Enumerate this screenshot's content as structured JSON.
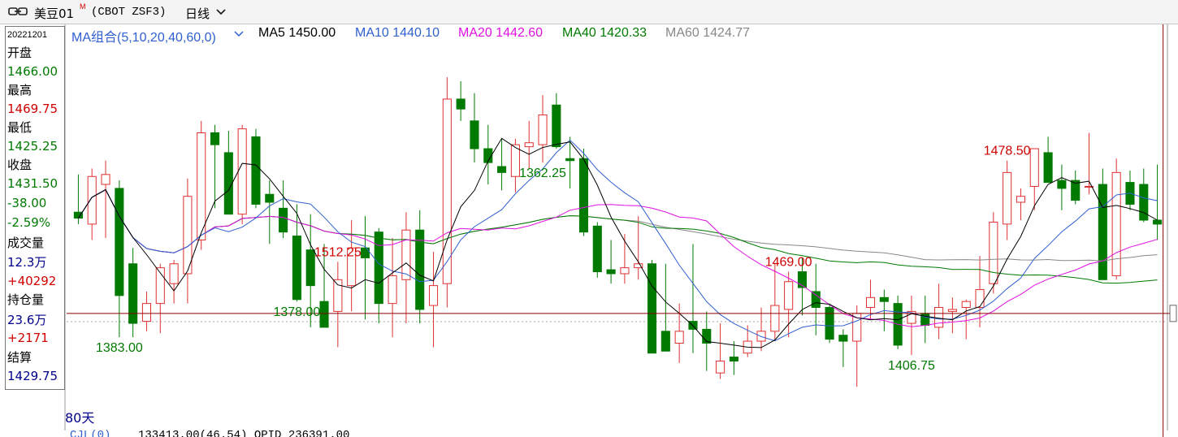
{
  "header": {
    "symbol": "美豆01",
    "symbol_sup": "M",
    "code": "(CBOT ZSF3)",
    "period": "日线",
    "icons": [
      "link-icon",
      "chevron-down-icon"
    ]
  },
  "side_panel": {
    "date": "20221201",
    "open_label": "开盘",
    "open": "1466.00",
    "high_label": "最高",
    "high": "1469.75",
    "low_label": "最低",
    "low": "1425.25",
    "close_label": "收盘",
    "close": "1431.50",
    "change": "-38.00",
    "change_pct": "-2.59%",
    "volume_label": "成交量",
    "volume": "12.3万",
    "volume_change": "+40292",
    "oi_label": "持仓量",
    "oi": "23.6万",
    "oi_change": "+2171",
    "settle_label": "结算",
    "settle": "1429.75"
  },
  "ma_legend": {
    "group": "MA组合(5,10,20,40,60,0)",
    "ma5": "MA5 1450.00",
    "ma10": "MA10 1440.10",
    "ma20": "MA20 1442.60",
    "ma40": "MA40 1420.33",
    "ma60": "MA60 1424.77"
  },
  "footer": {
    "days": "80天",
    "indicator": "CJL(0)",
    "values": "133413.00(46.54)   OPID 236391.00"
  },
  "colors": {
    "up": "#e03030",
    "down": "#007a00",
    "ma5": "#000000",
    "ma10": "#3060d0",
    "ma20": "#e010e0",
    "ma40": "#007a00",
    "ma60": "#888888",
    "crosshair": "#8b0000",
    "label_blue": "#00008b"
  },
  "chart_data": {
    "type": "candlestick",
    "ylim": [
      1345,
      1530
    ],
    "annotations": [
      {
        "label": "1512.25",
        "index": 19,
        "kind": "high"
      },
      {
        "label": "1383.00",
        "index": 3,
        "kind": "low"
      },
      {
        "label": "1378.00",
        "index": 16,
        "kind": "low"
      },
      {
        "label": "1362.25",
        "index": 34,
        "kind": "low"
      },
      {
        "label": "1469.00",
        "index": 52,
        "kind": "high"
      },
      {
        "label": "1406.75",
        "index": 61,
        "kind": "low"
      },
      {
        "label": "1478.50",
        "index": 68,
        "kind": "high"
      }
    ],
    "horizontal_reference": 1395,
    "candles": [
      {
        "o": 1446,
        "h": 1465,
        "l": 1440,
        "c": 1443
      },
      {
        "o": 1440,
        "h": 1468,
        "l": 1432,
        "c": 1464
      },
      {
        "o": 1460,
        "h": 1472,
        "l": 1433,
        "c": 1465
      },
      {
        "o": 1458,
        "h": 1462,
        "l": 1383,
        "c": 1404
      },
      {
        "o": 1420,
        "h": 1428,
        "l": 1383,
        "c": 1390
      },
      {
        "o": 1391,
        "h": 1406,
        "l": 1386,
        "c": 1400
      },
      {
        "o": 1400,
        "h": 1420,
        "l": 1385,
        "c": 1418
      },
      {
        "o": 1410,
        "h": 1422,
        "l": 1400,
        "c": 1420
      },
      {
        "o": 1415,
        "h": 1463,
        "l": 1400,
        "c": 1454
      },
      {
        "o": 1432,
        "h": 1492,
        "l": 1427,
        "c": 1486
      },
      {
        "o": 1486,
        "h": 1490,
        "l": 1448,
        "c": 1480
      },
      {
        "o": 1476,
        "h": 1487,
        "l": 1445,
        "c": 1445
      },
      {
        "o": 1445,
        "h": 1490,
        "l": 1440,
        "c": 1488
      },
      {
        "o": 1484,
        "h": 1488,
        "l": 1448,
        "c": 1450
      },
      {
        "o": 1455,
        "h": 1462,
        "l": 1430,
        "c": 1451
      },
      {
        "o": 1448,
        "h": 1462,
        "l": 1433,
        "c": 1436
      },
      {
        "o": 1434,
        "h": 1450,
        "l": 1401,
        "c": 1402
      },
      {
        "o": 1427,
        "h": 1445,
        "l": 1388,
        "c": 1409
      },
      {
        "o": 1401,
        "h": 1430,
        "l": 1388,
        "c": 1388
      },
      {
        "o": 1396,
        "h": 1421,
        "l": 1378,
        "c": 1412
      },
      {
        "o": 1409,
        "h": 1442,
        "l": 1396,
        "c": 1428
      },
      {
        "o": 1428,
        "h": 1444,
        "l": 1392,
        "c": 1423
      },
      {
        "o": 1436,
        "h": 1438,
        "l": 1390,
        "c": 1400
      },
      {
        "o": 1400,
        "h": 1433,
        "l": 1383,
        "c": 1414
      },
      {
        "o": 1412,
        "h": 1446,
        "l": 1390,
        "c": 1437
      },
      {
        "o": 1437,
        "h": 1447,
        "l": 1390,
        "c": 1397
      },
      {
        "o": 1399,
        "h": 1426,
        "l": 1378,
        "c": 1409
      },
      {
        "o": 1410,
        "h": 1514,
        "l": 1398,
        "c": 1503
      },
      {
        "o": 1503,
        "h": 1512,
        "l": 1492,
        "c": 1498
      },
      {
        "o": 1492,
        "h": 1506,
        "l": 1471,
        "c": 1478
      },
      {
        "o": 1478,
        "h": 1490,
        "l": 1460,
        "c": 1471
      },
      {
        "o": 1469,
        "h": 1483,
        "l": 1457,
        "c": 1466
      },
      {
        "o": 1464,
        "h": 1483,
        "l": 1456,
        "c": 1480
      },
      {
        "o": 1479,
        "h": 1492,
        "l": 1468,
        "c": 1481
      },
      {
        "o": 1480,
        "h": 1505,
        "l": 1471,
        "c": 1495
      },
      {
        "o": 1500,
        "h": 1506,
        "l": 1478,
        "c": 1479
      },
      {
        "o": 1473,
        "h": 1484,
        "l": 1458,
        "c": 1472
      },
      {
        "o": 1473,
        "h": 1478,
        "l": 1434,
        "c": 1436
      },
      {
        "o": 1439,
        "h": 1441,
        "l": 1413,
        "c": 1416
      },
      {
        "o": 1417,
        "h": 1432,
        "l": 1410,
        "c": 1415
      },
      {
        "o": 1415,
        "h": 1435,
        "l": 1410,
        "c": 1418
      },
      {
        "o": 1418,
        "h": 1444,
        "l": 1412,
        "c": 1420
      },
      {
        "o": 1420,
        "h": 1422,
        "l": 1394,
        "c": 1375
      },
      {
        "o": 1386,
        "h": 1420,
        "l": 1378,
        "c": 1376
      },
      {
        "o": 1380,
        "h": 1400,
        "l": 1370,
        "c": 1386
      },
      {
        "o": 1391,
        "h": 1430,
        "l": 1375,
        "c": 1387
      },
      {
        "o": 1387,
        "h": 1396,
        "l": 1366,
        "c": 1380
      },
      {
        "o": 1365,
        "h": 1390,
        "l": 1362,
        "c": 1371
      },
      {
        "o": 1373,
        "h": 1381,
        "l": 1364,
        "c": 1371
      },
      {
        "o": 1375,
        "h": 1389,
        "l": 1373,
        "c": 1381
      },
      {
        "o": 1381,
        "h": 1398,
        "l": 1376,
        "c": 1386
      },
      {
        "o": 1386,
        "h": 1420,
        "l": 1381,
        "c": 1399
      },
      {
        "o": 1397,
        "h": 1416,
        "l": 1383,
        "c": 1411
      },
      {
        "o": 1416,
        "h": 1423,
        "l": 1394,
        "c": 1408
      },
      {
        "o": 1406,
        "h": 1420,
        "l": 1384,
        "c": 1398
      },
      {
        "o": 1398,
        "h": 1400,
        "l": 1380,
        "c": 1382
      },
      {
        "o": 1384,
        "h": 1387,
        "l": 1368,
        "c": 1381
      },
      {
        "o": 1381,
        "h": 1399,
        "l": 1358,
        "c": 1395
      },
      {
        "o": 1398,
        "h": 1412,
        "l": 1392,
        "c": 1403
      },
      {
        "o": 1403,
        "h": 1407,
        "l": 1386,
        "c": 1401
      },
      {
        "o": 1400,
        "h": 1404,
        "l": 1377,
        "c": 1379
      },
      {
        "o": 1390,
        "h": 1404,
        "l": 1374,
        "c": 1396
      },
      {
        "o": 1395,
        "h": 1404,
        "l": 1380,
        "c": 1389
      },
      {
        "o": 1388,
        "h": 1410,
        "l": 1382,
        "c": 1398
      },
      {
        "o": 1396,
        "h": 1403,
        "l": 1385,
        "c": 1397
      },
      {
        "o": 1398,
        "h": 1402,
        "l": 1382,
        "c": 1401
      },
      {
        "o": 1398,
        "h": 1424,
        "l": 1388,
        "c": 1407
      },
      {
        "o": 1410,
        "h": 1446,
        "l": 1405,
        "c": 1441
      },
      {
        "o": 1440,
        "h": 1472,
        "l": 1432,
        "c": 1466
      },
      {
        "o": 1451,
        "h": 1458,
        "l": 1442,
        "c": 1454
      },
      {
        "o": 1459,
        "h": 1478,
        "l": 1447,
        "c": 1478
      },
      {
        "o": 1476,
        "h": 1484,
        "l": 1461,
        "c": 1461
      },
      {
        "o": 1462,
        "h": 1470,
        "l": 1447,
        "c": 1458
      },
      {
        "o": 1462,
        "h": 1467,
        "l": 1450,
        "c": 1452
      },
      {
        "o": 1459,
        "h": 1486,
        "l": 1455,
        "c": 1459
      },
      {
        "o": 1460,
        "h": 1468,
        "l": 1440,
        "c": 1412
      },
      {
        "o": 1414,
        "h": 1473,
        "l": 1412,
        "c": 1466
      },
      {
        "o": 1461,
        "h": 1467,
        "l": 1447,
        "c": 1450
      },
      {
        "o": 1460,
        "h": 1468,
        "l": 1441,
        "c": 1442
      },
      {
        "o": 1442,
        "h": 1470,
        "l": 1432,
        "c": 1440
      }
    ]
  }
}
